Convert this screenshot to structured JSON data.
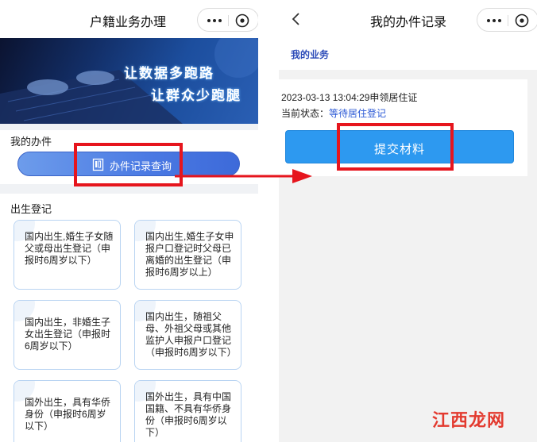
{
  "left_screen": {
    "title": "户籍业务办理",
    "banner": {
      "line1": "让数据多跑路",
      "line2": "让群众少跑腿"
    },
    "my_handling_label": "我的办件",
    "query_button_label": "办件记录查询",
    "birth_section_label": "出生登记",
    "cards": [
      "国内出生,婚生子女随父或母出生登记（申报时6周岁以下）",
      "国内出生,婚生子女申报户口登记时父母已离婚的出生登记（申报时6周岁以上）",
      "国内出生，非婚生子女出生登记（申报时6周岁以下）",
      "国内出生，随祖父母、外祖父母或其他监护人申报户口登记（申报时6周岁以下）",
      "国外出生，具有华侨身份（申报时6周岁以下）",
      "国外出生，具有中国国籍、不具有华侨身份（申报时6周岁以下）"
    ]
  },
  "right_screen": {
    "title": "我的办件记录",
    "my_business_label": "我的业务",
    "record": {
      "line": "2023-03-13 13:04:29申领居住证",
      "status_label": "当前状态：",
      "status_value": "等待居住登记"
    },
    "submit_button_label": "提交材料"
  },
  "watermark": "江西龙网",
  "colors": {
    "highlight": "#e6151d",
    "primary_button": "#2d99f0",
    "query_button": "#4a79e3",
    "status_text": "#2c5ad6",
    "card_border": "#b9d4f2"
  },
  "icons": [
    "chevron-left-icon",
    "more-dots-icon",
    "close-circle-icon",
    "document-icon",
    "arrow-right-icon"
  ]
}
